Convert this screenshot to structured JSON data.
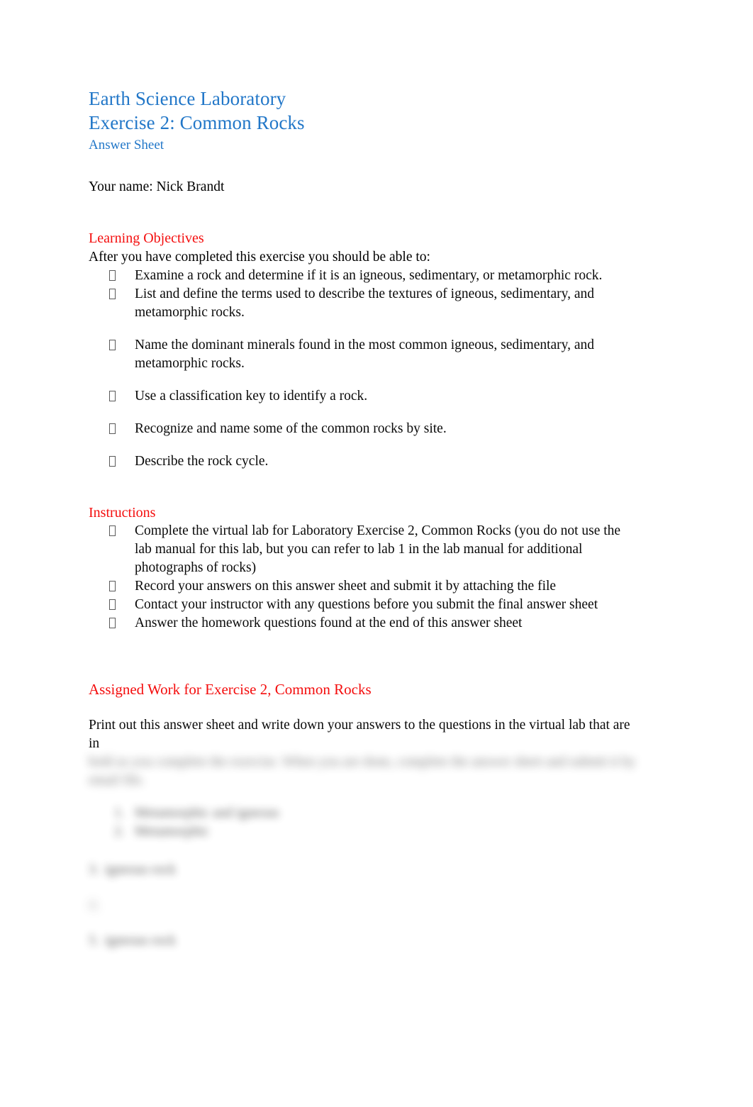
{
  "document": {
    "title_line1": "Earth Science Laboratory",
    "title_line2": "Exercise 2: Common Rocks",
    "subtitle": "Answer Sheet",
    "name_line": "Your name: Nick Brandt"
  },
  "colors": {
    "heading_blue": "#2277c8",
    "heading_red": "#f40d0d",
    "body_text": "#0a0a0a",
    "page_background": "#ffffff"
  },
  "learning_objectives": {
    "heading": "Learning Objectives",
    "lead_in": "After you have completed this exercise you should be able to:",
    "bullet_glyph": "tofu-box",
    "items": [
      "Examine a rock and determine if it is an igneous, sedimentary, or metamorphic rock.",
      "List and define the terms used to describe the textures of igneous, sedimentary, and metamorphic rocks.",
      "Name the dominant minerals found in the most common igneous, sedimentary, and metamorphic rocks.",
      "Use a classification key to identify a rock.",
      "Recognize and name some of the common rocks by site.",
      "Describe the rock cycle."
    ]
  },
  "instructions": {
    "heading": "Instructions",
    "bullet_glyph": "tofu-box",
    "items": [
      "Complete the virtual lab for Laboratory Exercise 2, Common Rocks (you do not use the lab manual for this lab, but you can refer to lab 1 in the lab manual for additional photographs of rocks)",
      "Record your answers on this answer sheet and submit it by attaching the file",
      "Contact your instructor with any questions before you submit the final answer sheet",
      "Answer the homework questions found at the end of this answer sheet"
    ]
  },
  "assigned_work": {
    "heading": "Assigned Work for Exercise 2, Common Rocks",
    "paragraph_visible": "Print out this answer sheet and write down your answers to the questions in the virtual lab that are in",
    "redacted_paragraph_lines": [
      "bold as you complete the exercise. When you are done, complete the answer sheet and submit it by",
      "email file."
    ],
    "redacted_list": [
      {
        "marker": "1.",
        "text": "Metamorphic and igneous"
      },
      {
        "marker": "2.",
        "text": "Metamorphic"
      }
    ],
    "redacted_answers": [
      {
        "marker": "3.",
        "text": "igneous rock"
      },
      {
        "marker": "4.",
        "text": ""
      },
      {
        "marker": "5.",
        "text": "igneous rock"
      }
    ]
  }
}
